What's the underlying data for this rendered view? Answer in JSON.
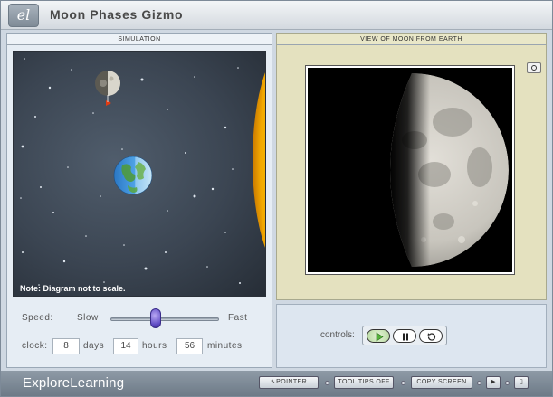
{
  "app": {
    "title": "Moon Phases Gizmo",
    "logo_glyph": "el"
  },
  "simulation": {
    "header": "SIMULATION",
    "note": "Note: Diagram not to scale.",
    "speed": {
      "label": "Speed:",
      "slow": "Slow",
      "fast": "Fast",
      "value": 0.42
    },
    "clock": {
      "label": "clock:",
      "days_value": "8",
      "days_label": "days",
      "hours_value": "14",
      "hours_label": "hours",
      "minutes_value": "56",
      "minutes_label": "minutes"
    }
  },
  "view": {
    "header": "VIEW OF MOON FROM EARTH",
    "camera_icon": "camera-icon",
    "phase": "first-quarter-waxing"
  },
  "controls": {
    "label": "controls:",
    "play_icon": "play-icon",
    "pause_icon": "pause-icon",
    "reset_icon": "reset-icon"
  },
  "footer": {
    "brand": "ExploreLearning",
    "pointer_label": "POINTER",
    "tooltips_label": "TOOL TIPS OFF",
    "copy_label": "COPY SCREEN"
  },
  "colors": {
    "sun": "#f2b800",
    "moon_lit": "#d9d6cc",
    "earth_blue": "#3d8fd6",
    "play_green": "#53b13a",
    "slider_thumb": "#5f4bc4"
  }
}
